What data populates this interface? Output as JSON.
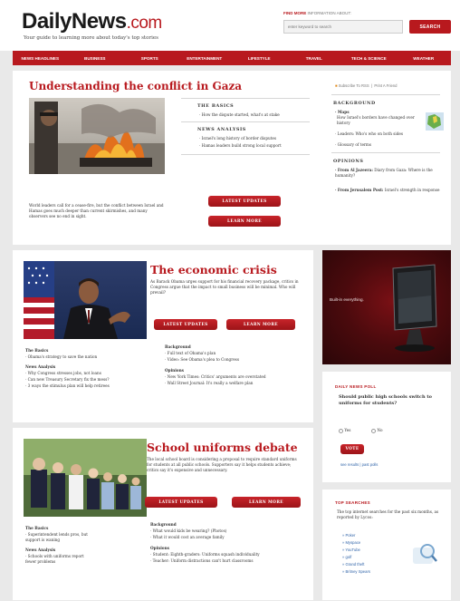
{
  "brand": {
    "name": "DailyNews",
    "suffix": ".com",
    "tagline": "Your guide to learning more about today's top stories"
  },
  "search": {
    "label_bold": "FIND MORE",
    "label_rest": "INFORMATION ABOUT:",
    "placeholder": "enter keyword to search",
    "button": "SEARCH"
  },
  "nav": [
    "NEWS HEADLINES",
    "BUSINESS",
    "SPORTS",
    "ENTERTAINMENT",
    "LIFESTYLE",
    "TRAVEL",
    "TECH & SCIENCE",
    "WEATHER"
  ],
  "gaza": {
    "headline": "Understanding the conflict in Gaza",
    "caption": "World leaders call for a cease-fire, but the conflict between Israel and Hamas goes much deeper than current skirmishes, and many observers see no end in sight.",
    "basics_title": "THE BASICS",
    "basics_items": [
      "· How the dispute started, what's at stake"
    ],
    "analysis_title": "NEWS ANALYSIS",
    "analysis_items": [
      "· Israel's long history of border disputes",
      "· Hamas leaders build strong local support"
    ],
    "btn_updates": "LATEST UPDATES",
    "btn_learn": "LEARN MORE",
    "subscribe": "Subscribe To RSS",
    "print": "Print A Friend",
    "background_title": "BACKGROUND",
    "bg_maps_title": "· Maps",
    "bg_maps_text": "How Israel's borders have changed over history",
    "bg_items": [
      "· Leaders: Who's who on both sides",
      "· Glossary of terms"
    ],
    "opinions_title": "OPINIONS",
    "op1_source": "· From Al Jazeera:",
    "op1_text": "Diary from Gaza: Where is the humanity?",
    "op2_source": "· From Jerusalem Post:",
    "op2_text": "Israel's strength in response"
  },
  "economy": {
    "headline": "The economic crisis",
    "summary": "As Barack Obama urges support for his financial recovery package, critics in Congress argue that the impact to small business will be minimal. Who will prevail?",
    "btn_updates": "LATEST UPDATES",
    "btn_learn": "LEARN MORE",
    "basics_title": "The Basics",
    "basics_items": [
      "· Obama's strategy to save the nation"
    ],
    "analysis_title": "News Analysis",
    "analysis_items": [
      "· Why Congress stresses jobs, not loans",
      "· Can new Treasury Secretary fix the mess?",
      "· 3 ways the stimulus plan will help retirees"
    ],
    "background_title": "Background",
    "background_items": [
      "· Full text of Obama's plan",
      "· Video: See Obama's plea to Congress"
    ],
    "opinions_title": "Opinions",
    "opinions_items": [
      "· New York Times: Critics' arguments are overstated",
      "· Wall Street Journal: It's really a welfare plan"
    ]
  },
  "school": {
    "headline": "School uniforms debate",
    "summary": "The local school board is considering a proposal to require standard uniforms for students at all public schools. Supporters say it helps students achieve; critics say it's expensive and unnecessary.",
    "btn_updates": "LATEST UPDATES",
    "btn_learn": "LEARN MORE",
    "basics_title": "The Basics",
    "basics_items": [
      "· Superintendent lends pros, but",
      "  support is waning"
    ],
    "analysis_title": "News Analysis",
    "analysis_items": [
      "· Schools with uniforms report",
      "  fewer problems"
    ],
    "background_title": "Background",
    "background_items": [
      "· What would kids be wearing? (Photos)",
      "· What it would cost an average family"
    ],
    "opinions_title": "Opinions",
    "opinions_items": [
      "· Student: Eighth-graders: Uniforms squash individuality",
      "· Teacher: Uniform distractions can't hurt classrooms"
    ]
  },
  "ad": {
    "text": "Built-in everything."
  },
  "poll": {
    "title": "DAILY NEWS POLL",
    "question": "Should public high schools switch to uniforms for students?",
    "options": [
      "Yes",
      "No"
    ],
    "vote": "VOTE",
    "results_link": "see results | past polls"
  },
  "top_searches": {
    "title": "TOP SEARCHES",
    "intro": "The top internet searches for the past six months, as reported by Lycos:",
    "items": [
      "» Poker",
      "» Myspace",
      "» YouTube",
      "» golf",
      "» Grand theft",
      "» Britney Spears"
    ]
  },
  "colors": {
    "accent": "#b8191e",
    "link": "#3366aa",
    "background": "#e9e9e9"
  }
}
